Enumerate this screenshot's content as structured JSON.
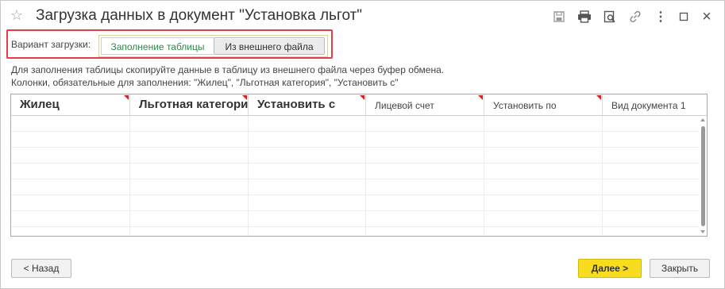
{
  "window": {
    "title": "Загрузка данных в документ \"Установка льгот\"",
    "star_glyph": "☆",
    "toolbar_icons": [
      "save-icon",
      "print-icon",
      "preview-icon",
      "link-icon",
      "more-icon",
      "maximize-icon",
      "close-icon"
    ],
    "more_glyph": "⋮",
    "close_glyph": "×"
  },
  "variant": {
    "label": "Вариант загрузки:",
    "options": [
      "Заполнение таблицы",
      "Из внешнего файла"
    ],
    "selected": "Заполнение таблицы",
    "accent": "#e0404a",
    "selected_color": "#2f8a4a"
  },
  "hint": {
    "line1": "Для заполнения таблицы скопируйте данные в таблицу из внешнего файла через буфер обмена.",
    "line2": "Колонки, обязательные для заполнения: \"Жилец\", \"Льготная категория\", \"Установить с\""
  },
  "table": {
    "columns": [
      "Жилец",
      "Льготная категория",
      "Установить с",
      "Лицевой счет",
      "Установить по",
      "Вид документа 1"
    ],
    "rows": []
  },
  "buttons": {
    "back": "< Назад",
    "next": "Далее >",
    "close": "Закрыть",
    "primary_color": "#f8dd1e"
  }
}
